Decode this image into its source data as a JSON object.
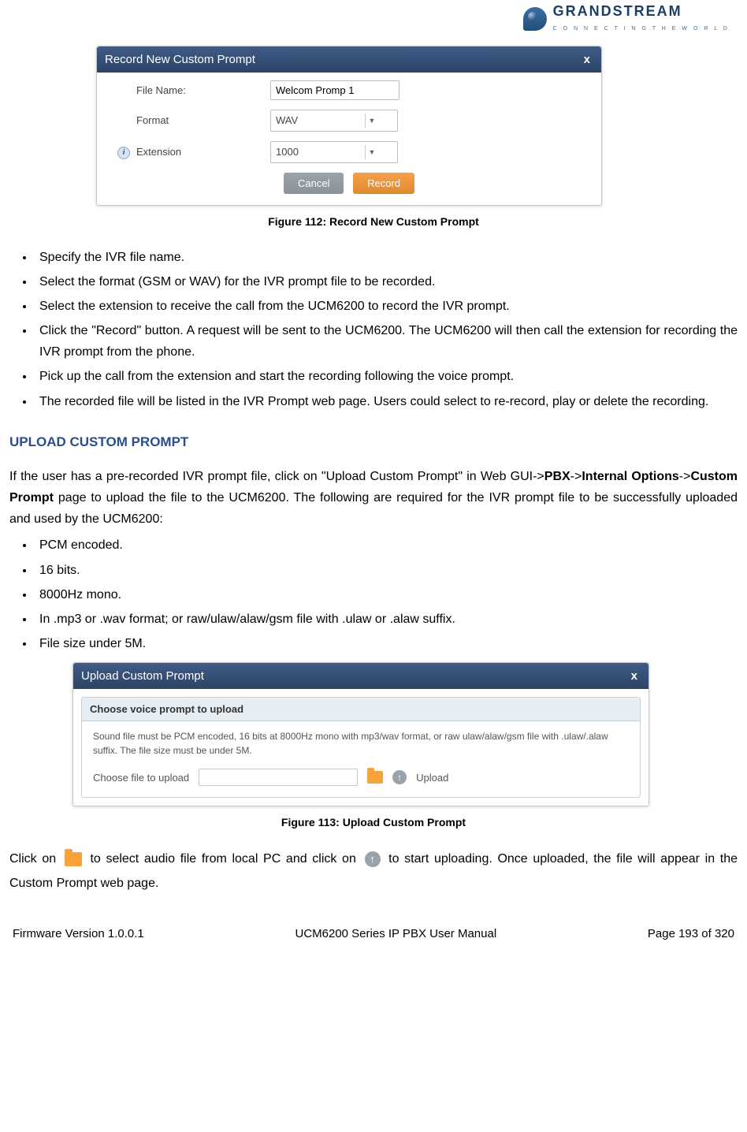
{
  "logo": {
    "main": "GRANDSTREAM",
    "sub": "C O N N E C T I N G   T H E   W O R L D"
  },
  "dialog1": {
    "title": "Record New Custom Prompt",
    "close": "x",
    "rows": {
      "filename_label": "File Name:",
      "filename_value": "Welcom Promp 1",
      "format_label": "Format",
      "format_value": "WAV",
      "extension_label": "Extension",
      "extension_value": "1000"
    },
    "buttons": {
      "cancel": "Cancel",
      "record": "Record"
    }
  },
  "fig1": "Figure 112: Record New Custom Prompt",
  "list1": [
    "Specify the IVR file name.",
    "Select the format (GSM or WAV) for the IVR prompt file to be recorded.",
    "Select the extension to receive the call from the UCM6200 to record the IVR prompt.",
    "Click the \"Record\" button. A request will be sent to the UCM6200. The UCM6200 will then call the extension for recording the IVR prompt from the phone.",
    "Pick up the call from the extension and start the recording following the voice prompt.",
    "The recorded file will be listed in the IVR Prompt web page. Users could select to re-record, play or delete the recording."
  ],
  "section_upload": "UPLOAD CUSTOM PROMPT",
  "para_upload": {
    "pre": "If the user has a pre-recorded IVR prompt file, click on \"Upload Custom Prompt\" in Web GUI->",
    "b1": "PBX",
    "mid1": "->",
    "b2": "Internal Options",
    "mid2": "->",
    "b3": "Custom Prompt",
    "post": " page to upload the file to the UCM6200. The following are required for the IVR prompt file to be successfully uploaded and used by the UCM6200:"
  },
  "list2": [
    "PCM encoded.",
    "16 bits.",
    "8000Hz mono.",
    "In .mp3 or .wav format; or raw/ulaw/alaw/gsm file with .ulaw or .alaw suffix.",
    "File size under 5M."
  ],
  "dialog2": {
    "title": "Upload Custom Prompt",
    "close": "x",
    "sub_title": "Choose voice prompt to upload",
    "hint": "Sound file must be PCM encoded, 16 bits at 8000Hz mono with mp3/wav format, or raw ulaw/alaw/gsm file with .ulaw/.alaw suffix. The file size must be under 5M.",
    "choose_label": "Choose file to upload",
    "upload_label": "Upload"
  },
  "fig2": "Figure 113: Upload Custom Prompt",
  "closing": {
    "p1": "Click on ",
    "p2": " to select audio file from local PC and click on ",
    "p3": " to start uploading. Once uploaded, the file will appear in the Custom Prompt web page."
  },
  "footer": {
    "left": "Firmware Version 1.0.0.1",
    "mid": "UCM6200 Series IP PBX User Manual",
    "right": "Page 193 of 320"
  }
}
